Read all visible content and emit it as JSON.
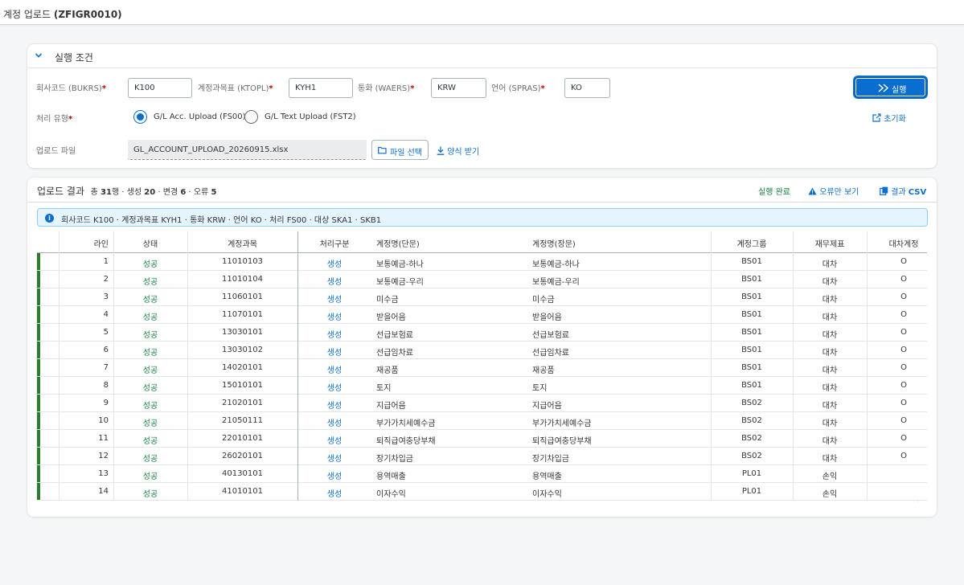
{
  "app": {
    "title_prefix": "계정 업로드 ",
    "title_code": "(ZFIGR0010)"
  },
  "criteria": {
    "section_title": "실행 조건",
    "fields": {
      "bukrs": {
        "label": "회사코드 (BUKRS)",
        "value": "K100"
      },
      "ktopl": {
        "label": "계정과목표 (KTOPL)",
        "value": "KYH1"
      },
      "waers": {
        "label": "통화 (WAERS)",
        "value": "KRW"
      },
      "spras": {
        "label": "언어 (SPRAS)",
        "value": "KO"
      }
    },
    "required_mark": "*",
    "process_type_label": "처리 유형",
    "radio_options": [
      "G/L Acc. Upload (FS00)",
      "G/L Text Upload (FST2)"
    ],
    "selected_radio": 0,
    "file_label": "업로드 파일",
    "file_value": "GL_ACCOUNT_UPLOAD_20260915.xlsx",
    "buttons": {
      "run": "실행",
      "reset": "초기화",
      "select_file": "파일 선택",
      "download_template": "양식 받기"
    }
  },
  "results": {
    "title": "업로드 결과",
    "summary": {
      "p1": "총 ",
      "total": "31",
      "p2": "행 · 생성 ",
      "created": "20",
      "p3": " · 변경 ",
      "changed": "6",
      "p4": " · 오류 ",
      "errors": "5"
    },
    "status_text": "실행 완료",
    "errors_only": "오류만 보기",
    "csv_prefix": "결과 ",
    "csv_bold": "CSV",
    "info": "회사코드 K100 · 계정과목표 KYH1 · 통화 KRW · 언어 KO · 처리 FS00 · 대상 SKA1 · SKB1",
    "columns": [
      "라인",
      "상태",
      "계정과목",
      "처리구분",
      "계정명(단문)",
      "계정명(장문)",
      "계정그룹",
      "재무제표",
      "대차계정"
    ],
    "rows": [
      [
        "1",
        "성공",
        "11010103",
        "생성",
        "보통예금-하나",
        "보통예금-하나",
        "BS01",
        "대차",
        "O"
      ],
      [
        "2",
        "성공",
        "11010104",
        "생성",
        "보통예금-우리",
        "보통예금-우리",
        "BS01",
        "대차",
        "O"
      ],
      [
        "3",
        "성공",
        "11060101",
        "생성",
        "미수금",
        "미수금",
        "BS01",
        "대차",
        "O"
      ],
      [
        "4",
        "성공",
        "11070101",
        "생성",
        "받을어음",
        "받을어음",
        "BS01",
        "대차",
        "O"
      ],
      [
        "5",
        "성공",
        "13030101",
        "생성",
        "선급보험료",
        "선급보험료",
        "BS01",
        "대차",
        "O"
      ],
      [
        "6",
        "성공",
        "13030102",
        "생성",
        "선급임차료",
        "선급임차료",
        "BS01",
        "대차",
        "O"
      ],
      [
        "7",
        "성공",
        "14020101",
        "생성",
        "재공품",
        "재공품",
        "BS01",
        "대차",
        "O"
      ],
      [
        "8",
        "성공",
        "15010101",
        "생성",
        "토지",
        "토지",
        "BS01",
        "대차",
        "O"
      ],
      [
        "9",
        "성공",
        "21020101",
        "생성",
        "지급어음",
        "지급어음",
        "BS02",
        "대차",
        "O"
      ],
      [
        "10",
        "성공",
        "21050111",
        "생성",
        "부가가치세예수금",
        "부가가치세예수금",
        "BS02",
        "대차",
        "O"
      ],
      [
        "11",
        "성공",
        "22010101",
        "생성",
        "퇴직급여충당부채",
        "퇴직급여충당부채",
        "BS02",
        "대차",
        "O"
      ],
      [
        "12",
        "성공",
        "26020101",
        "생성",
        "장기차입금",
        "장기차입금",
        "BS02",
        "대차",
        "O"
      ],
      [
        "13",
        "성공",
        "40130101",
        "생성",
        "용역매출",
        "용역매출",
        "PL01",
        "손익",
        ""
      ],
      [
        "14",
        "성공",
        "41010101",
        "생성",
        "이자수익",
        "이자수익",
        "PL01",
        "손익",
        ""
      ]
    ]
  },
  "colors": {
    "brand": "#0a6ed1",
    "success": "#107e3e",
    "required": "#bb0000",
    "row_status_bar": "#2b7c2b"
  }
}
